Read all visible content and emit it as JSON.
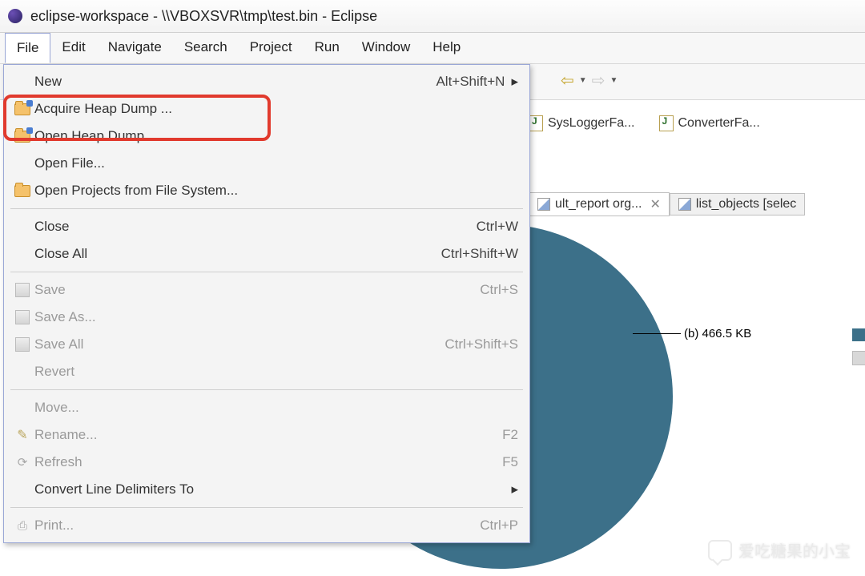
{
  "title": "eclipse-workspace - \\\\VBOXSVR\\tmp\\test.bin - Eclipse",
  "menubar": [
    "File",
    "Edit",
    "Navigate",
    "Search",
    "Project",
    "Run",
    "Window",
    "Help"
  ],
  "file_menu": {
    "groups": [
      [
        {
          "label": "New",
          "shortcut": "Alt+Shift+N",
          "submenu": true,
          "icon": ""
        },
        {
          "label": "Acquire Heap Dump ...",
          "icon": "folder-blue"
        },
        {
          "label": "Open Heap Dump...",
          "icon": "folder-blue"
        },
        {
          "label": "Open File...",
          "icon": ""
        },
        {
          "label": "Open Projects from File System...",
          "icon": "folder"
        }
      ],
      [
        {
          "label": "Close",
          "shortcut": "Ctrl+W"
        },
        {
          "label": "Close All",
          "shortcut": "Ctrl+Shift+W"
        }
      ],
      [
        {
          "label": "Save",
          "shortcut": "Ctrl+S",
          "icon": "disk",
          "disabled": true
        },
        {
          "label": "Save As...",
          "icon": "disk",
          "disabled": true
        },
        {
          "label": "Save All",
          "shortcut": "Ctrl+Shift+S",
          "icon": "disk",
          "disabled": true
        },
        {
          "label": "Revert",
          "disabled": true
        }
      ],
      [
        {
          "label": "Move...",
          "disabled": true
        },
        {
          "label": "Rename...",
          "shortcut": "F2",
          "icon": "pen",
          "disabled": true
        },
        {
          "label": "Refresh",
          "shortcut": "F5",
          "icon": "refresh",
          "disabled": true
        },
        {
          "label": "Convert Line Delimiters To",
          "submenu": true
        }
      ],
      [
        {
          "label": "Print...",
          "shortcut": "Ctrl+P",
          "icon": "print",
          "disabled": true
        }
      ]
    ]
  },
  "editor_files": [
    "SysLoggerFa...",
    "ConverterFa..."
  ],
  "tabs": [
    {
      "label": "ult_report  org...",
      "active": true,
      "closable": true
    },
    {
      "label": "list_objects [selec",
      "active": false
    }
  ],
  "callout": "(b)  466.5 KB",
  "watermark": "爱吃糖果的小宝"
}
